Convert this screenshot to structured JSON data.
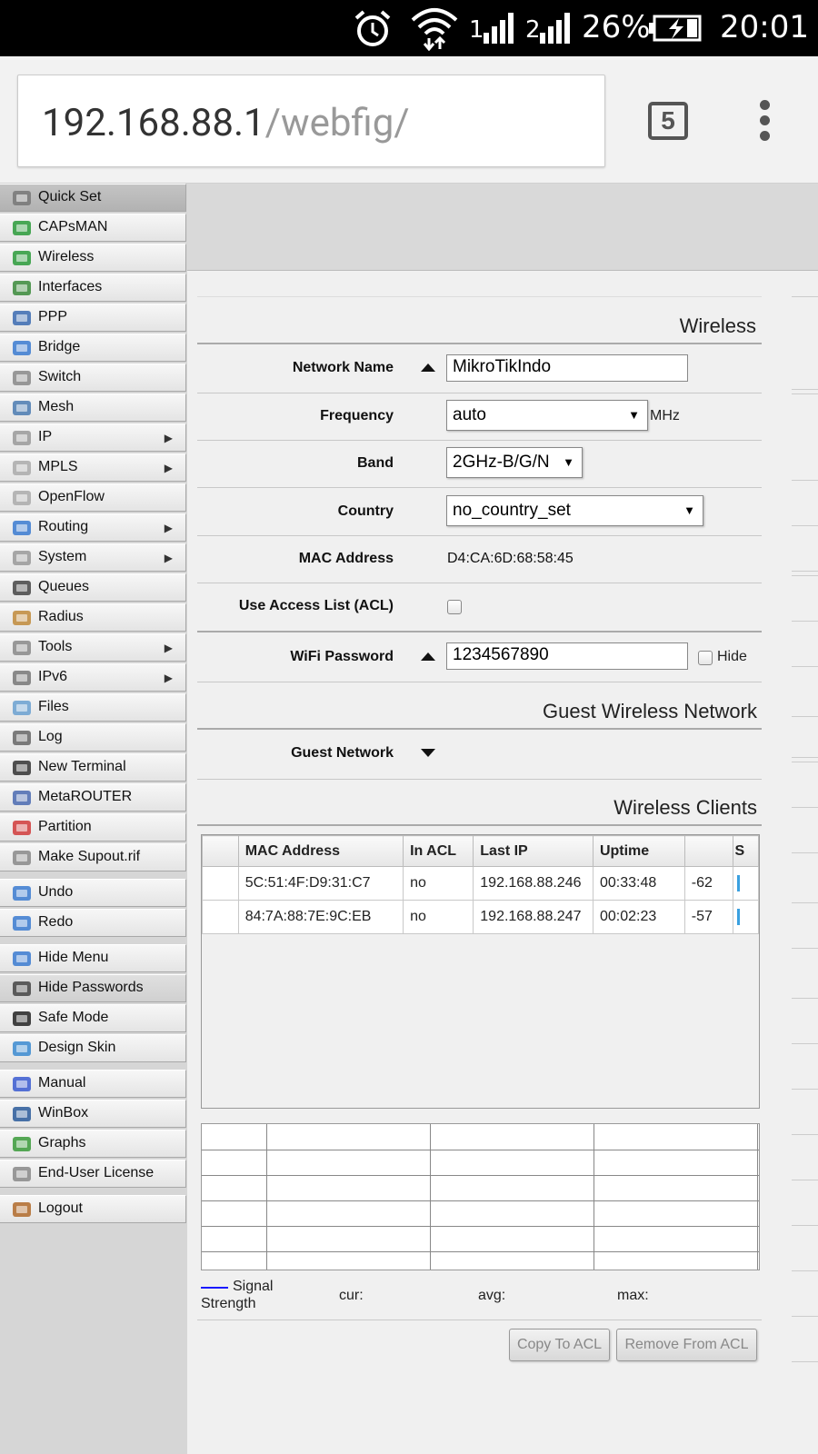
{
  "status_bar": {
    "battery": "26%",
    "time": "20:01",
    "signal_sim1": "1",
    "signal_sim2": "2"
  },
  "browser": {
    "url_host": "192.168.88.1",
    "url_path": "/webfig/",
    "tab_count": "5"
  },
  "sidebar": {
    "items": [
      {
        "label": "Quick Set",
        "icon": "wand-icon"
      },
      {
        "label": "CAPsMAN",
        "icon": "antenna-icon"
      },
      {
        "label": "Wireless",
        "icon": "antenna-icon"
      },
      {
        "label": "Interfaces",
        "icon": "nic-icon"
      },
      {
        "label": "PPP",
        "icon": "ppp-icon"
      },
      {
        "label": "Bridge",
        "icon": "bridge-icon"
      },
      {
        "label": "Switch",
        "icon": "switch-icon"
      },
      {
        "label": "Mesh",
        "icon": "mesh-icon"
      },
      {
        "label": "IP",
        "icon": "ip-icon",
        "arrow": "▶"
      },
      {
        "label": "MPLS",
        "icon": "mpls-icon",
        "arrow": "▶"
      },
      {
        "label": "OpenFlow",
        "icon": "openflow-icon"
      },
      {
        "label": "Routing",
        "icon": "routing-icon",
        "arrow": "▶"
      },
      {
        "label": "System",
        "icon": "gear-icon",
        "arrow": "▶"
      },
      {
        "label": "Queues",
        "icon": "queues-icon"
      },
      {
        "label": "Radius",
        "icon": "users-icon"
      },
      {
        "label": "Tools",
        "icon": "tools-icon",
        "arrow": "▶"
      },
      {
        "label": "IPv6",
        "icon": "ipv6-icon",
        "arrow": "▶"
      },
      {
        "label": "Files",
        "icon": "folder-icon"
      },
      {
        "label": "Log",
        "icon": "log-icon"
      },
      {
        "label": "New Terminal",
        "icon": "terminal-icon"
      },
      {
        "label": "MetaROUTER",
        "icon": "metarouter-icon"
      },
      {
        "label": "Partition",
        "icon": "pie-icon"
      },
      {
        "label": "Make Supout.rif",
        "icon": "document-icon"
      },
      {
        "label": "Undo",
        "icon": "undo-icon"
      },
      {
        "label": "Redo",
        "icon": "redo-icon"
      },
      {
        "label": "Hide Menu",
        "icon": "hide-menu-icon"
      },
      {
        "label": "Hide Passwords",
        "icon": "password-dots-icon"
      },
      {
        "label": "Safe Mode",
        "icon": "umbrella-icon"
      },
      {
        "label": "Design Skin",
        "icon": "skin-icon"
      },
      {
        "label": "Manual",
        "icon": "help-icon"
      },
      {
        "label": "WinBox",
        "icon": "winbox-icon"
      },
      {
        "label": "Graphs",
        "icon": "graph-icon"
      },
      {
        "label": "End-User License",
        "icon": "license-icon"
      },
      {
        "label": "Logout",
        "icon": "logout-icon"
      }
    ]
  },
  "wireless": {
    "title": "Wireless",
    "network_name_label": "Network Name",
    "network_name": "MikroTikIndo",
    "frequency_label": "Frequency",
    "frequency": "auto",
    "frequency_unit": "MHz",
    "band_label": "Band",
    "band": "2GHz-B/G/N",
    "country_label": "Country",
    "country": "no_country_set",
    "mac_label": "MAC Address",
    "mac": "D4:CA:6D:68:58:45",
    "acl_label": "Use Access List (ACL)",
    "password_label": "WiFi Password",
    "password": "1234567890",
    "hide_label": "Hide"
  },
  "guest": {
    "title": "Guest Wireless Network",
    "network_label": "Guest Network"
  },
  "clients": {
    "title": "Wireless Clients",
    "columns": [
      "",
      "MAC Address",
      "In ACL",
      "Last IP",
      "Uptime",
      "",
      "S"
    ],
    "rows": [
      {
        "mac": "5C:51:4F:D9:31:C7",
        "acl": "no",
        "ip": "192.168.88.246",
        "uptime": "00:33:48",
        "signal": "-62"
      },
      {
        "mac": "84:7A:88:7E:9C:EB",
        "acl": "no",
        "ip": "192.168.88.247",
        "uptime": "00:02:23",
        "signal": "-57"
      }
    ]
  },
  "graph": {
    "legend_line1": "Signal",
    "legend_line2": "Strength",
    "cur": "cur:",
    "avg": "avg:",
    "max": "max:",
    "line_color": "#1a1aff"
  },
  "buttons": {
    "copy_acl": "Copy To ACL",
    "remove_acl": "Remove From ACL"
  }
}
